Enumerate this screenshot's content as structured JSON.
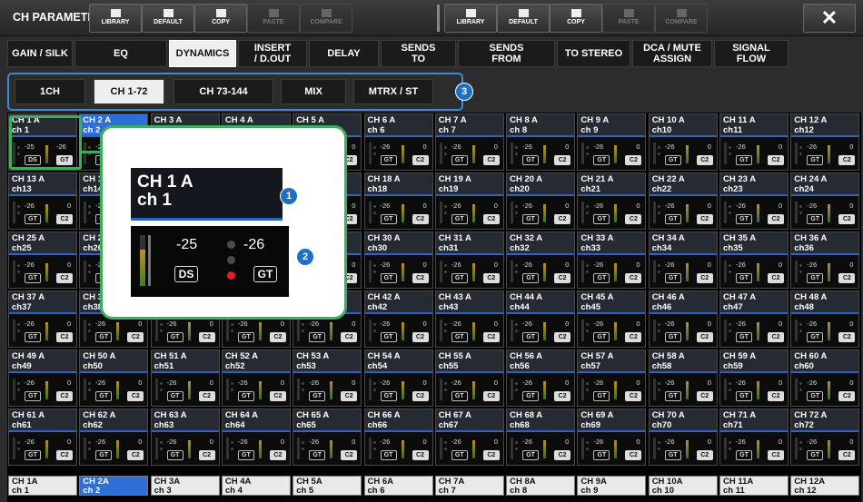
{
  "title": "CH PARAMETER",
  "toolbar": [
    {
      "label": "LIBRARY",
      "icon": "folder-icon",
      "enabled": true
    },
    {
      "label": "DEFAULT",
      "icon": "document-icon",
      "enabled": true
    },
    {
      "label": "COPY",
      "icon": "copy-icon",
      "enabled": true
    },
    {
      "label": "PASTE",
      "icon": "paste-icon",
      "enabled": false
    },
    {
      "label": "COMPARE",
      "icon": "compare-icon",
      "enabled": false
    },
    {
      "label": "LIBRARY",
      "icon": "folder-icon",
      "enabled": true
    },
    {
      "label": "DEFAULT",
      "icon": "document-icon",
      "enabled": true
    },
    {
      "label": "COPY",
      "icon": "copy-icon",
      "enabled": true
    },
    {
      "label": "PASTE",
      "icon": "paste-icon",
      "enabled": false
    },
    {
      "label": "COMPARE",
      "icon": "compare-icon",
      "enabled": false
    }
  ],
  "close_label": "✕",
  "tabs": [
    {
      "label": "GAIN / SILK",
      "selected": false
    },
    {
      "label": "EQ",
      "selected": false
    },
    {
      "label": "DYNAMICS",
      "selected": true
    },
    {
      "label": "INSERT\n/ D.OUT",
      "selected": false
    },
    {
      "label": "DELAY",
      "selected": false
    },
    {
      "label": "SENDS\nTO",
      "selected": false
    },
    {
      "label": "SENDS\nFROM",
      "selected": false
    },
    {
      "label": "TO STEREO",
      "selected": false
    },
    {
      "label": "DCA / MUTE\nASSIGN",
      "selected": false
    },
    {
      "label": "SIGNAL\nFLOW",
      "selected": false
    }
  ],
  "pages": [
    {
      "label": "1CH",
      "selected": false
    },
    {
      "label": "CH 1-72",
      "selected": true
    },
    {
      "label": "CH 73-144",
      "selected": false
    },
    {
      "label": "MIX",
      "selected": false
    },
    {
      "label": "MTRX / ST",
      "selected": false
    }
  ],
  "cell_values": {
    "left": "-26",
    "right": "0",
    "first_left": "-25",
    "first_right": "-26"
  },
  "cell_buttons": {
    "ds": "DS",
    "gt": "GT",
    "c2": "C2"
  },
  "zoom": {
    "name_line1": "CH 1 A",
    "name_line2": "ch 1",
    "dyn1": "-25",
    "dyn2": "-26",
    "ds": "DS",
    "gt": "GT"
  },
  "callouts": [
    "1",
    "2",
    "3"
  ],
  "colors": {
    "accent": "#2d6fd6",
    "callout": "#1f6fc4",
    "highlight": "#3cae5e",
    "red_dot": "#e02020"
  }
}
